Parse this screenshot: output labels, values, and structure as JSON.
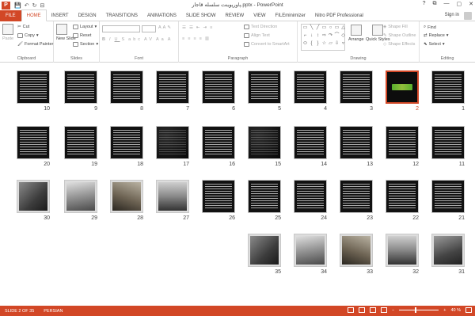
{
  "window": {
    "app_icon": "P",
    "title": "پاورپوینت سلسله قاجار.pptx - PowerPoint",
    "controls": [
      "?",
      "⧉",
      "—",
      "▢",
      "✕"
    ]
  },
  "qat": {
    "save": "💾",
    "undo": "↶",
    "redo": "↻",
    "start": "⊟"
  },
  "tabs": [
    "FILE",
    "HOME",
    "INSERT",
    "DESIGN",
    "TRANSITIONS",
    "ANIMATIONS",
    "SLIDE SHOW",
    "REVIEW",
    "VIEW",
    "FILEminimizer",
    "Nitro PDF Professional"
  ],
  "active_tab": "HOME",
  "signin": "Sign in",
  "ribbon": {
    "clipboard": {
      "label": "Clipboard",
      "paste": "Paste",
      "cut": "Cut",
      "copy": "Copy",
      "format_painter": "Format Painter"
    },
    "slides": {
      "label": "Slides",
      "new_slide": "New Slide",
      "layout": "Layout",
      "reset": "Reset",
      "section": "Section"
    },
    "font": {
      "label": "Font"
    },
    "paragraph": {
      "label": "Paragraph",
      "text_direction": "Text Direction",
      "align_text": "Align Text",
      "smartart": "Convert to SmartArt"
    },
    "drawing": {
      "label": "Drawing",
      "arrange": "Arrange",
      "quick_styles": "Quick Styles",
      "shape_fill": "Shape Fill",
      "shape_outline": "Shape Outline",
      "shape_effects": "Shape Effects"
    },
    "editing": {
      "label": "Editing",
      "find": "Find",
      "replace": "Replace",
      "select": "Select"
    }
  },
  "slides": [
    {
      "n": "1",
      "kind": "text"
    },
    {
      "n": "2",
      "kind": "title",
      "selected": true
    },
    {
      "n": "3",
      "kind": "text"
    },
    {
      "n": "4",
      "kind": "text"
    },
    {
      "n": "5",
      "kind": "text"
    },
    {
      "n": "6",
      "kind": "text"
    },
    {
      "n": "7",
      "kind": "text"
    },
    {
      "n": "8",
      "kind": "text"
    },
    {
      "n": "9",
      "kind": "text"
    },
    {
      "n": "10",
      "kind": "text"
    },
    {
      "n": "11",
      "kind": "text"
    },
    {
      "n": "12",
      "kind": "text"
    },
    {
      "n": "13",
      "kind": "text"
    },
    {
      "n": "14",
      "kind": "text"
    },
    {
      "n": "15",
      "kind": "dark"
    },
    {
      "n": "16",
      "kind": "text"
    },
    {
      "n": "17",
      "kind": "dark"
    },
    {
      "n": "18",
      "kind": "text"
    },
    {
      "n": "19",
      "kind": "text"
    },
    {
      "n": "20",
      "kind": "text"
    },
    {
      "n": "21",
      "kind": "text"
    },
    {
      "n": "22",
      "kind": "text"
    },
    {
      "n": "23",
      "kind": "text"
    },
    {
      "n": "24",
      "kind": "text"
    },
    {
      "n": "25",
      "kind": "text"
    },
    {
      "n": "26",
      "kind": "text"
    },
    {
      "n": "27",
      "kind": "photo"
    },
    {
      "n": "28",
      "kind": "photo"
    },
    {
      "n": "29",
      "kind": "photo"
    },
    {
      "n": "30",
      "kind": "photo"
    },
    {
      "n": "31",
      "kind": "photo"
    },
    {
      "n": "32",
      "kind": "photo"
    },
    {
      "n": "33",
      "kind": "photo"
    },
    {
      "n": "34",
      "kind": "photo"
    },
    {
      "n": "35",
      "kind": "photo"
    }
  ],
  "status": {
    "slide": "SLIDE 2 OF 35",
    "language": "PERSIAN",
    "zoom": "40 %",
    "minus": "−",
    "plus": "+"
  },
  "colors": {
    "accent": "#d24726"
  }
}
